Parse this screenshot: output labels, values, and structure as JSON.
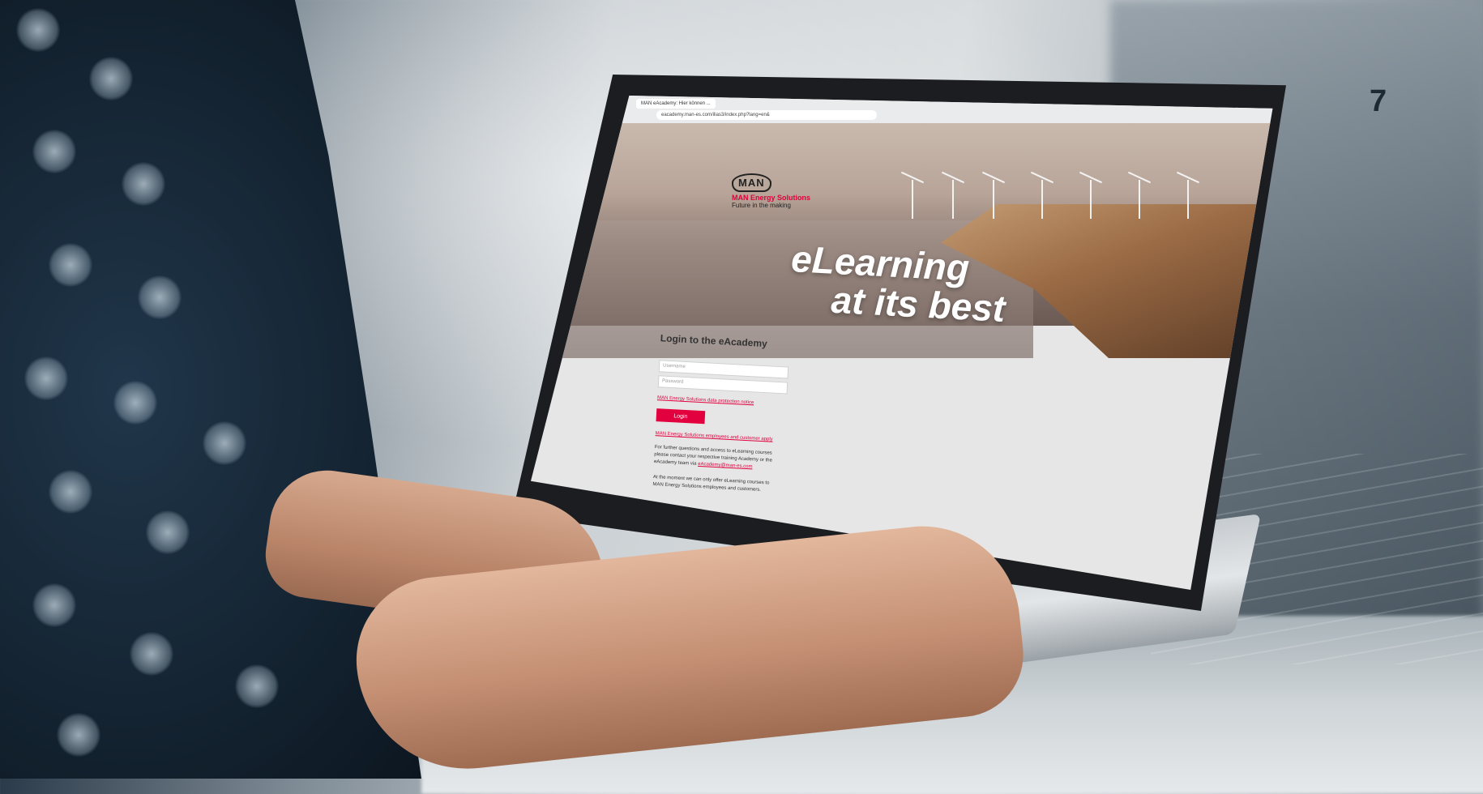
{
  "page_number": "7",
  "browser": {
    "tab_label": "MAN eAcademy: Hier können ...",
    "url": "eacademy.man-es.com/ilias3/index.php?lang=en&"
  },
  "brand": {
    "badge": "MAN",
    "name": "MAN Energy Solutions",
    "tagline": "Future in the making",
    "accent_color": "#e2003e"
  },
  "hero": {
    "line1": "eLearning",
    "line2": "at its best"
  },
  "login": {
    "heading": "Login to the eAcademy",
    "username_placeholder": "Username",
    "password_placeholder": "Password",
    "notice_link": "MAN Energy Solutions data protection notice",
    "button_label": "Login",
    "register_link": "MAN Energy Solutions employees and customer apply",
    "info_text": "For further questions and access to eLearning courses please contact your respective training Academy or the eAcademy team via",
    "info_email": "eAcademy@man-es.com",
    "availability_text": "At the moment we can only offer eLearning courses to MAN Energy Solutions employees and customers."
  }
}
